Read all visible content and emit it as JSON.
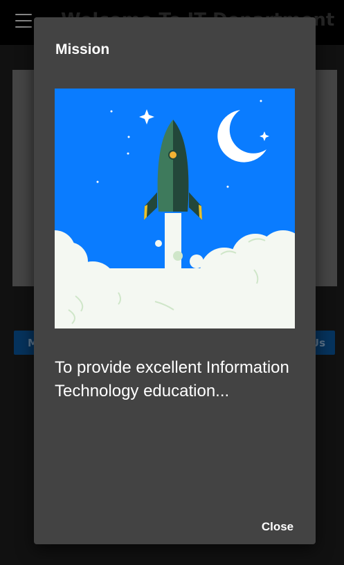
{
  "app_bar": {
    "title": "Welcome To IT Department"
  },
  "background": {
    "left_button_label": "M",
    "right_button_label": "Us"
  },
  "dialog": {
    "title": "Mission",
    "body": "To provide excellent Information Technology education...",
    "close_label": "Close"
  },
  "colors": {
    "sky": "#0a7cff",
    "cloud": "#f4f8f2",
    "rocket_body": "#3e7a5c",
    "rocket_shade": "#23473a",
    "window": "#f2b134",
    "dialog_bg": "#434343"
  }
}
